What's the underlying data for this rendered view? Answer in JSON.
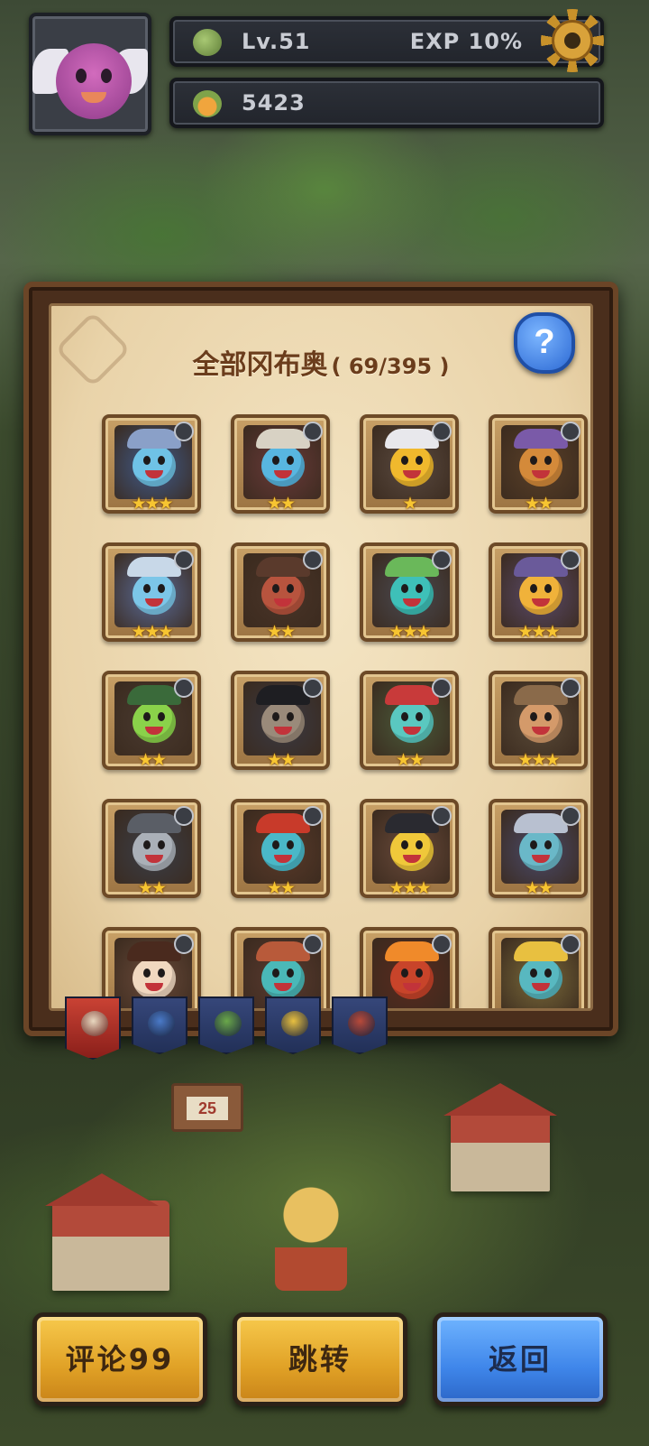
{
  "hud": {
    "level": "Lv.51",
    "exp": "EXP 10%",
    "coins": "5423",
    "settings_icon": "gear-icon"
  },
  "panel": {
    "title": "全部冈布奥",
    "count": "( 69/395 )",
    "help_label": "?"
  },
  "cards": [
    {
      "stars": "★★★",
      "color": "#6fc2e6",
      "hat": "#8aa0c8",
      "bg": "#3f5b8c"
    },
    {
      "stars": "★★",
      "color": "#58b6e0",
      "hat": "#d8d2c4",
      "bg": "#6a3a3a"
    },
    {
      "stars": "★",
      "color": "#f0b92d",
      "hat": "#e8e8ec",
      "bg": "#5a4a40"
    },
    {
      "stars": "★★",
      "color": "#d48a3a",
      "hat": "#7a5aa8",
      "bg": "#5a4028"
    },
    {
      "stars": "★★★",
      "color": "#7cc6e8",
      "hat": "#c8d8e8",
      "bg": "#5a6c9a"
    },
    {
      "stars": "★★",
      "color": "#b8543e",
      "hat": "#5a3a2c",
      "bg": "#4a3428"
    },
    {
      "stars": "★★★",
      "color": "#3ec0b8",
      "hat": "#6ab85a",
      "bg": "#4a4a52"
    },
    {
      "stars": "★★★",
      "color": "#f0b23a",
      "hat": "#6a5a9a",
      "bg": "#5a4a6a"
    },
    {
      "stars": "★★",
      "color": "#8ad24a",
      "hat": "#3a6a3a",
      "bg": "#4a3a30"
    },
    {
      "stars": "★★",
      "color": "#9a8a7a",
      "hat": "#1e1e22",
      "bg": "#3a3a44"
    },
    {
      "stars": "★★",
      "color": "#5ac8c0",
      "hat": "#c83a3a",
      "bg": "#4a5a3a"
    },
    {
      "stars": "★★★",
      "color": "#d49a6a",
      "hat": "#8a6a4a",
      "bg": "#5a4a38"
    },
    {
      "stars": "★★",
      "color": "#aab0b8",
      "hat": "#5a5e66",
      "bg": "#3a3e48"
    },
    {
      "stars": "★★",
      "color": "#4ab8c8",
      "hat": "#c83a2a",
      "bg": "#5a3a2a"
    },
    {
      "stars": "★★★",
      "color": "#f0c83a",
      "hat": "#2a2a30",
      "bg": "#6a4a3a"
    },
    {
      "stars": "★★",
      "color": "#6ab8c8",
      "hat": "#b8c0d0",
      "bg": "#4a4a6a"
    },
    {
      "stars": "",
      "color": "#f0d8c0",
      "hat": "#4a2a1e",
      "bg": "#6a4a3a"
    },
    {
      "stars": "",
      "color": "#4ab8b8",
      "hat": "#b85a3a",
      "bg": "#5a3a30"
    },
    {
      "stars": "",
      "color": "#c8442a",
      "hat": "#f08a2a",
      "bg": "#5a2a1e"
    },
    {
      "stars": "",
      "color": "#58b8c0",
      "hat": "#e8c040",
      "bg": "#7a6a3a"
    }
  ],
  "tabs": [
    {
      "icon": "all-faction-icon",
      "color": "#e8d8c0"
    },
    {
      "icon": "blue-faction-icon",
      "color": "#4a7ac8"
    },
    {
      "icon": "green-faction-icon",
      "color": "#6aa84a"
    },
    {
      "icon": "yellow-faction-icon",
      "color": "#e8c040"
    },
    {
      "icon": "red-faction-icon",
      "color": "#b84a3a"
    }
  ],
  "scene": {
    "sign_number": "25"
  },
  "buttons": {
    "comment": "评论99",
    "jump": "跳转",
    "back": "返回"
  }
}
